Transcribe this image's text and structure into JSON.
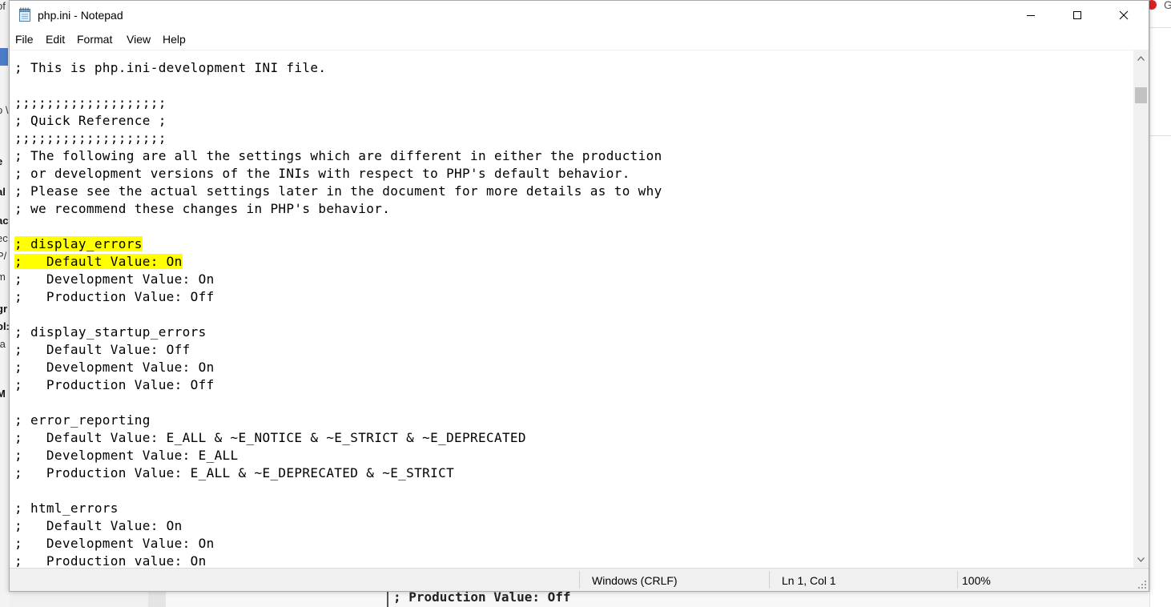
{
  "window": {
    "title": "php.ini - Notepad"
  },
  "menu": {
    "items": [
      "File",
      "Edit",
      "Format",
      "View",
      "Help"
    ]
  },
  "editor": {
    "highlight_color": "#ffff00",
    "lines": [
      "",
      "; This is php.ini-development INI file.",
      "",
      ";;;;;;;;;;;;;;;;;;;",
      "; Quick Reference ;",
      ";;;;;;;;;;;;;;;;;;;",
      "; The following are all the settings which are different in either the production",
      "; or development versions of the INIs with respect to PHP's default behavior.",
      "; Please see the actual settings later in the document for more details as to why",
      "; we recommend these changes in PHP's behavior.",
      "",
      "; display_errors",
      ";   Default Value: On",
      ";   Development Value: On",
      ";   Production Value: Off",
      "",
      "; display_startup_errors",
      ";   Default Value: Off",
      ";   Development Value: On",
      ";   Production Value: Off",
      "",
      "; error_reporting",
      ";   Default Value: E_ALL & ~E_NOTICE & ~E_STRICT & ~E_DEPRECATED",
      ";   Development Value: E_ALL",
      ";   Production Value: E_ALL & ~E_DEPRECATED & ~E_STRICT",
      "",
      "; html_errors",
      ";   Default Value: On",
      ";   Development Value: On",
      ";   Production value: On"
    ]
  },
  "statusbar": {
    "line_ending": "Windows (CRLF)",
    "position": "Ln 1, Col 1",
    "zoom": "100%"
  },
  "background": {
    "left_fragments": [
      "of",
      "o \\",
      "e",
      "al",
      "ac",
      "ec",
      "P/",
      "m",
      "gr",
      "ol:",
      "ta",
      "M"
    ],
    "right_letter": "G",
    "bottom_text": "; Production Value: Off"
  }
}
